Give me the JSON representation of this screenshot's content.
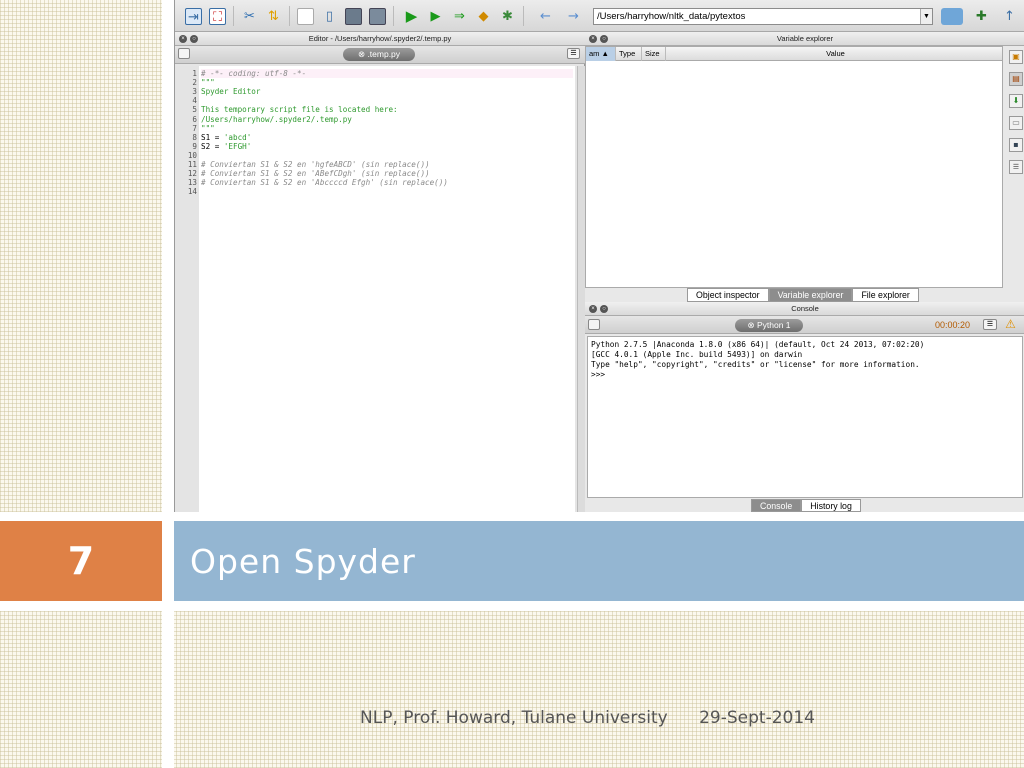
{
  "slide": {
    "number": "7",
    "title": "Open Spyder",
    "footer_course": "NLP, Prof. Howard, Tulane University",
    "footer_date": "29-Sept-2014",
    "accent_orange": "#df8146",
    "accent_blue": "#94b6d2"
  },
  "toolbar": {
    "path": "/Users/harryhow/nltk_data/pytextos",
    "icons": [
      "new-window-icon",
      "maximize-icon",
      "tools-icon",
      "upload-icon",
      "new-file-icon",
      "open-file-icon",
      "save-icon",
      "save-all-icon",
      "run-icon",
      "run-config-icon",
      "re-run-icon",
      "debug-icon",
      "step-icon",
      "back-arrow-icon",
      "forward-arrow-icon",
      "folder-icon",
      "python-path-icon",
      "up-arrow-icon"
    ]
  },
  "editor": {
    "title": "Editor - /Users/harryhow/.spyder2/.temp.py",
    "tab_label": ".temp.py",
    "lines": [
      {
        "n": "1",
        "text": "# -*- coding: utf-8 -*-",
        "color": "#8a8a8a",
        "italic": true
      },
      {
        "n": "2",
        "text": "\"\"\"",
        "color": "#2f9a2f",
        "italic": false
      },
      {
        "n": "3",
        "text": "Spyder Editor",
        "color": "#2f9a2f",
        "italic": false
      },
      {
        "n": "4",
        "text": "",
        "color": "#000",
        "italic": false
      },
      {
        "n": "5",
        "text": "This temporary script file is located here:",
        "color": "#2f9a2f",
        "italic": false
      },
      {
        "n": "6",
        "text": "/Users/harryhow/.spyder2/.temp.py",
        "color": "#2f9a2f",
        "italic": false
      },
      {
        "n": "7",
        "text": "\"\"\"",
        "color": "#2f9a2f",
        "italic": false
      },
      {
        "n": "8",
        "text": "S1 = ",
        "extra": "'abcd'",
        "color": "#000",
        "italic": false
      },
      {
        "n": "9",
        "text": "S2 = ",
        "extra": "'EFGH'",
        "color": "#000",
        "italic": false
      },
      {
        "n": "10",
        "text": "",
        "color": "#000",
        "italic": false
      },
      {
        "n": "11",
        "text": "# Conviertan S1 & S2 en 'hgfeABCD' (sin replace())",
        "color": "#8a8a8a",
        "italic": true
      },
      {
        "n": "12",
        "text": "# Conviertan S1 & S2 en 'ABefCDgh' (sin replace())",
        "color": "#8a8a8a",
        "italic": true
      },
      {
        "n": "13",
        "text": "# Conviertan S1 & S2 en 'Abccccd Efgh' (sin replace())",
        "color": "#8a8a8a",
        "italic": true
      },
      {
        "n": "14",
        "text": "",
        "color": "#000",
        "italic": false
      }
    ]
  },
  "variable_explorer": {
    "title": "Variable explorer",
    "columns": [
      "am ▲",
      "Type",
      "Size",
      "Value"
    ],
    "tabs": [
      "Object inspector",
      "Variable explorer",
      "File explorer"
    ],
    "active_tab": "Variable explorer"
  },
  "console": {
    "title": "Console",
    "tab_label": "Python 1",
    "timer": "00:00:20",
    "lines": [
      "Python 2.7.5 |Anaconda 1.8.0 (x86 64)| (default, Oct 24 2013, 07:02:20)",
      "[GCC 4.0.1 (Apple Inc. build 5493)] on darwin",
      "Type \"help\", \"copyright\", \"credits\" or \"license\" for more information.",
      ">>>"
    ],
    "tabs": [
      "Console",
      "History log"
    ],
    "active_tab": "Console"
  }
}
